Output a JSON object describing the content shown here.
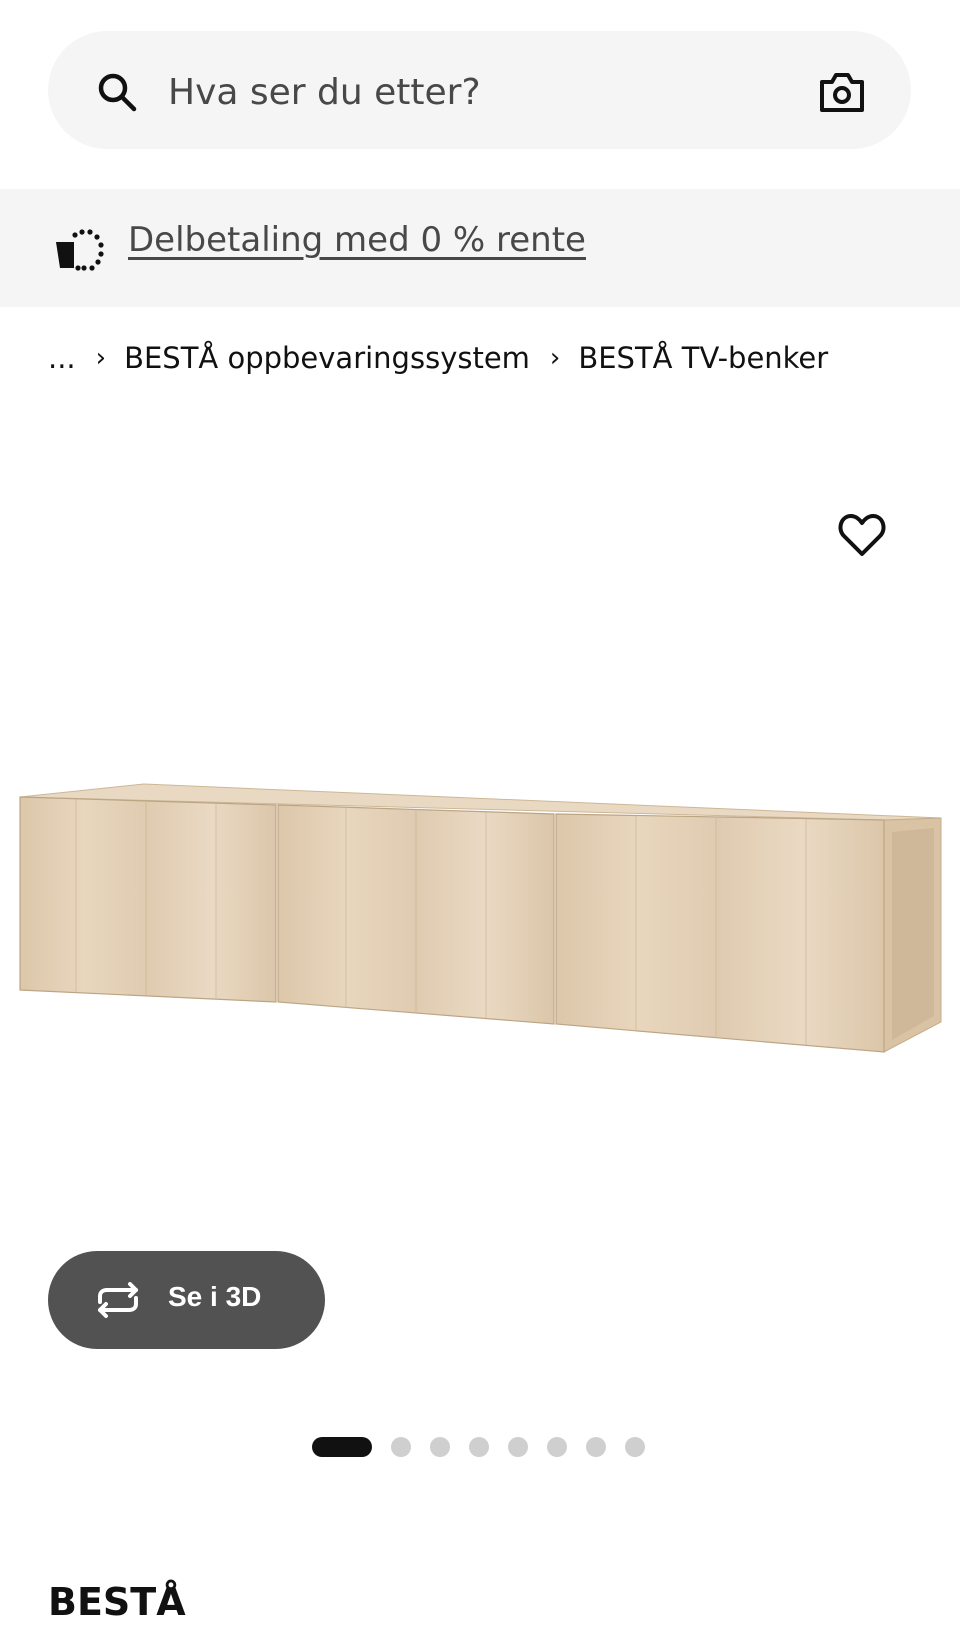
{
  "search": {
    "placeholder": "Hva ser du etter?"
  },
  "banner": {
    "link_label": "Delbetaling med 0 % rente"
  },
  "breadcrumb": {
    "ellipsis": "...",
    "items": [
      {
        "label": "BESTÅ oppbevaringssystem"
      },
      {
        "label": "BESTÅ TV-benker"
      }
    ]
  },
  "gallery": {
    "view_3d_label": "Se i 3D",
    "image_count": 8,
    "active_index": 0
  },
  "product": {
    "name": "BESTÅ"
  },
  "colors": {
    "search_bg": "#f5f5f5",
    "banner_bg": "#f5f5f5",
    "button_3d_bg": "#525252",
    "dot_active": "#111111",
    "dot_inactive": "#cfcfcf",
    "wood_front": "#e2cfb4",
    "wood_top": "#ead9c2"
  },
  "icons": {
    "search": "search-icon",
    "camera": "camera-icon",
    "installment": "installment-icon",
    "favourite": "heart-icon",
    "rotate_3d": "rotate-3d-icon",
    "breadcrumb_separator": "chevron-right-icon"
  }
}
